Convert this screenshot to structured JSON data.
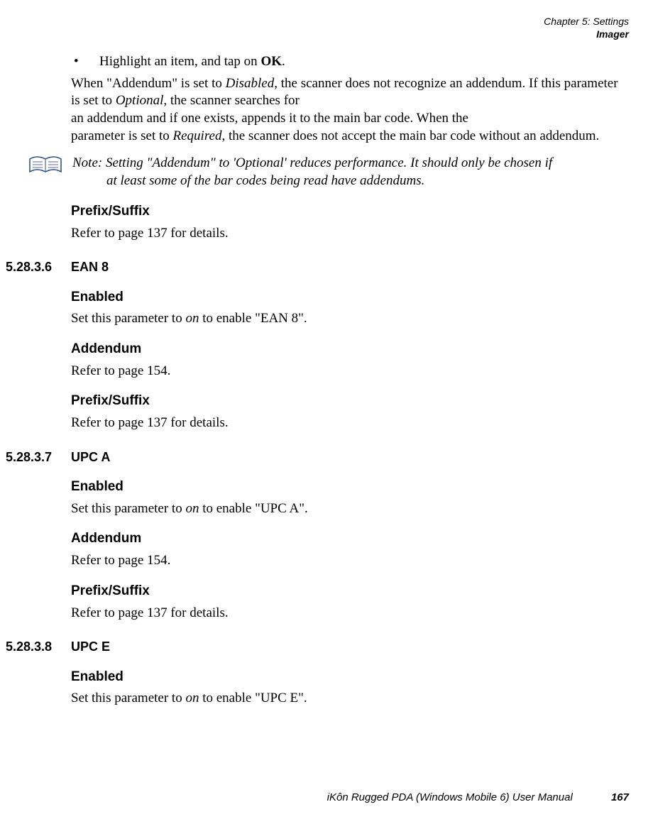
{
  "header": {
    "chapter_line": "Chapter 5: Settings",
    "subline": "Imager"
  },
  "intro": {
    "bullet_prefix": "Highlight an item, and tap on ",
    "bullet_bold": "OK",
    "bullet_suffix": ".",
    "para_1a": "When \"Addendum\" is set to ",
    "para_1_em1": "Disabled",
    "para_1b": ", the scanner does not recognize an addendum. If this parameter is set to ",
    "para_1_em2": "Optional",
    "para_1c": ", the scanner searches for",
    "para_2": "an addendum and if one exists, appends it to the main bar code. When the",
    "para_3a": "parameter is set to ",
    "para_3_em": "Required",
    "para_3b": ", the scanner does not accept the main bar code without an addendum."
  },
  "note": {
    "label": "Note:",
    "line1": "Setting \"Addendum\" to 'Optional' reduces performance. It should only be chosen if",
    "line2": "at least some of the bar codes being read have addendums."
  },
  "prefix_suffix": {
    "heading": "Prefix/Suffix",
    "text": "Refer to page 137 for details."
  },
  "sections": {
    "ean8": {
      "num": "5.28.3.6",
      "title": "EAN 8",
      "enabled_h": "Enabled",
      "enabled_t1": "Set this parameter to ",
      "enabled_em": "on",
      "enabled_t2": " to enable \"EAN 8\".",
      "add_h": "Addendum",
      "add_t": "Refer to page 154.",
      "ps_h": "Prefix/Suffix",
      "ps_t": "Refer to page 137 for details."
    },
    "upca": {
      "num": "5.28.3.7",
      "title": "UPC A",
      "enabled_h": "Enabled",
      "enabled_t1": "Set this parameter to ",
      "enabled_em": "on",
      "enabled_t2": " to enable \"UPC A\".",
      "add_h": "Addendum",
      "add_t": "Refer to page 154.",
      "ps_h": "Prefix/Suffix",
      "ps_t": "Refer to page 137 for details."
    },
    "upce": {
      "num": "5.28.3.8",
      "title": "UPC E",
      "enabled_h": "Enabled",
      "enabled_t1": "Set this parameter to ",
      "enabled_em": "on",
      "enabled_t2": " to enable \"UPC E\"."
    }
  },
  "footer": {
    "doc_title": "iKôn Rugged PDA (Windows Mobile 6) User Manual",
    "page": "167"
  }
}
